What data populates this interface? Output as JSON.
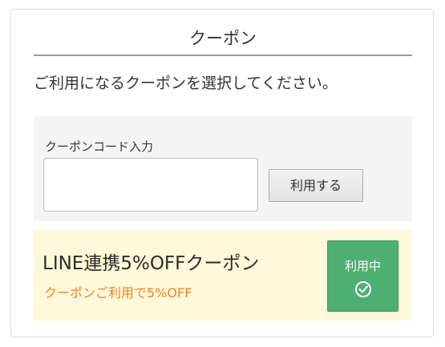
{
  "header": {
    "title": "クーポン"
  },
  "instruction": "ご利用になるクーポンを選択してください。",
  "code_entry": {
    "label": "クーポンコード入力",
    "input_value": "",
    "apply_label": "利用する"
  },
  "coupon": {
    "name": "LINE連携5%OFFクーポン",
    "description": "クーポンご利用で5%OFF",
    "status_label": "利用中",
    "status_icon": "check-circle-icon"
  },
  "colors": {
    "accent_green": "#4fae72",
    "discount_orange": "#f08323",
    "coupon_background": "#fdf9da",
    "panel_background": "#f4f4f4"
  }
}
